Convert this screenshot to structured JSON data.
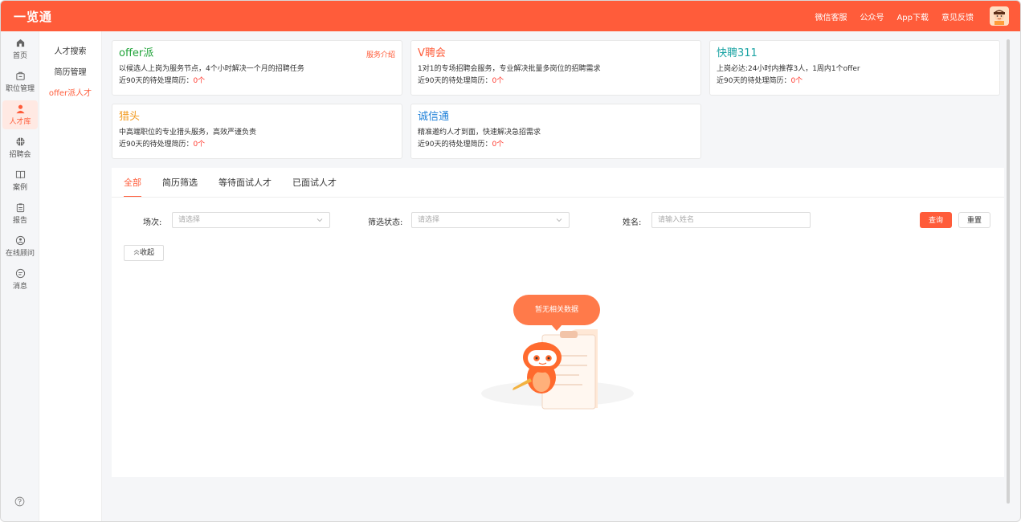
{
  "app": {
    "title": "一览通"
  },
  "top_links": [
    "微信客服",
    "公众号",
    "App下载",
    "意见反馈"
  ],
  "rail": {
    "items": [
      {
        "label": "首页",
        "icon": "home-icon"
      },
      {
        "label": "职位管理",
        "icon": "briefcase-icon"
      },
      {
        "label": "人才库",
        "icon": "person-icon",
        "active": true
      },
      {
        "label": "招聘会",
        "icon": "basketball-icon"
      },
      {
        "label": "案例",
        "icon": "book-icon"
      },
      {
        "label": "报告",
        "icon": "clipboard-icon"
      },
      {
        "label": "在线顾问",
        "icon": "advisor-icon"
      },
      {
        "label": "消息",
        "icon": "message-icon"
      }
    ]
  },
  "submenu": {
    "items": [
      {
        "label": "人才搜索"
      },
      {
        "label": "简历管理"
      },
      {
        "label": "offer派人才",
        "active": true
      }
    ]
  },
  "cards": [
    {
      "title": "offer派",
      "color": "#21a33a",
      "desc": "以候选人上岗为服务节点，4个小时解决一个月的招聘任务",
      "count_label": "近90天的待处理简历：",
      "count": "0个",
      "link": "服务介绍"
    },
    {
      "title": "V聘会",
      "color": "#ff5c3a",
      "desc": "1对1的专场招聘会服务，专业解决批量多岗位的招聘需求",
      "count_label": "近90天的待处理简历：",
      "count": "0个"
    },
    {
      "title": "快聘311",
      "color": "#1aa3a3",
      "desc": "上岗必达:24小时内推荐3人，1周内1个offer",
      "count_label": "近90天的待处理简历：",
      "count": "0个"
    },
    {
      "title": "猎头",
      "color": "#f29a1e",
      "desc": "中高端职位的专业猎头服务，高效严谨负责",
      "count_label": "近90天的待处理简历：",
      "count": "0个"
    },
    {
      "title": "诚信通",
      "color": "#1f80d8",
      "desc": "精准邀约人才到面，快速解决急招需求",
      "count_label": "近90天的待处理简历：",
      "count": "0个"
    }
  ],
  "tabs": [
    {
      "label": "全部",
      "active": true
    },
    {
      "label": "简历筛选"
    },
    {
      "label": "等待面试人才"
    },
    {
      "label": "已面试人才"
    }
  ],
  "filters": {
    "session_label": "场次:",
    "session_placeholder": "请选择",
    "status_label": "筛选状态:",
    "status_placeholder": "请选择",
    "name_label": "姓名:",
    "name_placeholder": "请输入姓名",
    "query_label": "查询",
    "reset_label": "重置",
    "collapse_label": "收起"
  },
  "empty": {
    "message": "暂无相关数据"
  },
  "colors": {
    "accent": "#ff5c3a"
  }
}
